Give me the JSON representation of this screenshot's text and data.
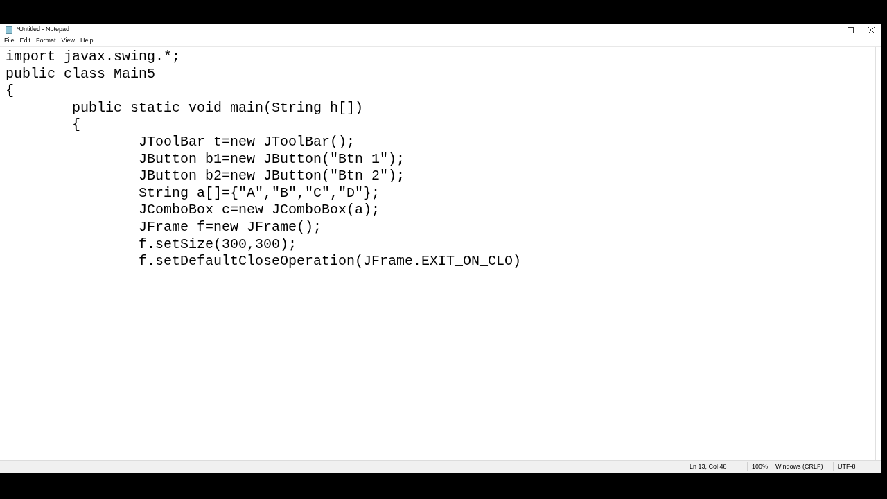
{
  "window": {
    "title": "*Untitled - Notepad"
  },
  "menu": [
    "File",
    "Edit",
    "Format",
    "View",
    "Help"
  ],
  "editor": {
    "lines": [
      "import javax.swing.*;",
      "public class Main5",
      "{",
      "\tpublic static void main(String h[])",
      "\t{",
      "\t\tJToolBar t=new JToolBar();",
      "\t\tJButton b1=new JButton(\"Btn 1\");",
      "\t\tJButton b2=new JButton(\"Btn 2\");",
      "\t\tString a[]={\"A\",\"B\",\"C\",\"D\"};",
      "\t\tJComboBox c=new JComboBox(a);",
      "\t\tJFrame f=new JFrame();",
      "\t\tf.setSize(300,300);",
      "\t\tf.setDefaultCloseOperation(JFrame.EXIT_ON_CLO)"
    ]
  },
  "status_bar": {
    "position": "Ln 13, Col 48",
    "zoom": "100%",
    "line_ending": "Windows (CRLF)",
    "encoding": "UTF-8"
  }
}
